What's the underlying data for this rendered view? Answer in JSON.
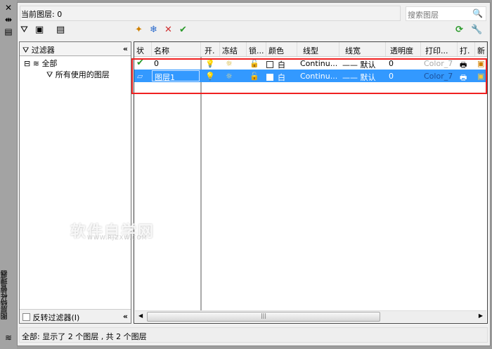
{
  "window": {
    "vertical_title": "图层特性管理器"
  },
  "header": {
    "current_layer": "当前图层: 0",
    "search_placeholder": "搜索图层"
  },
  "filter_panel": {
    "title": "过滤器",
    "tree": [
      {
        "label": "全部"
      },
      {
        "label": "所有使用的图层"
      }
    ],
    "invert_label": "反转过滤器(I)",
    "invert_checked": false
  },
  "grid": {
    "columns": [
      "状",
      "名称",
      "开.",
      "冻结",
      "锁...",
      "颜色",
      "线型",
      "线宽",
      "透明度",
      "打印...",
      "打.",
      "新"
    ],
    "rows": [
      {
        "status": "current",
        "name": "0",
        "color": "白",
        "linetype": "Continu...",
        "lineweight": "默认",
        "transparency": "0",
        "plot_style": "Color_7",
        "selected": false
      },
      {
        "status": "layer",
        "name": "图层1",
        "color": "白",
        "linetype": "Continu...",
        "lineweight": "默认",
        "transparency": "0",
        "plot_style": "Color_7",
        "selected": true
      }
    ]
  },
  "status_bar": "全部: 显示了 2 个图层 , 共 2 个图层",
  "watermark": {
    "text": "软件自学网",
    "url": "WWW.RJZXW.COM"
  },
  "colors": {
    "selection": "#3399ff",
    "highlight_box": "#f02020"
  }
}
